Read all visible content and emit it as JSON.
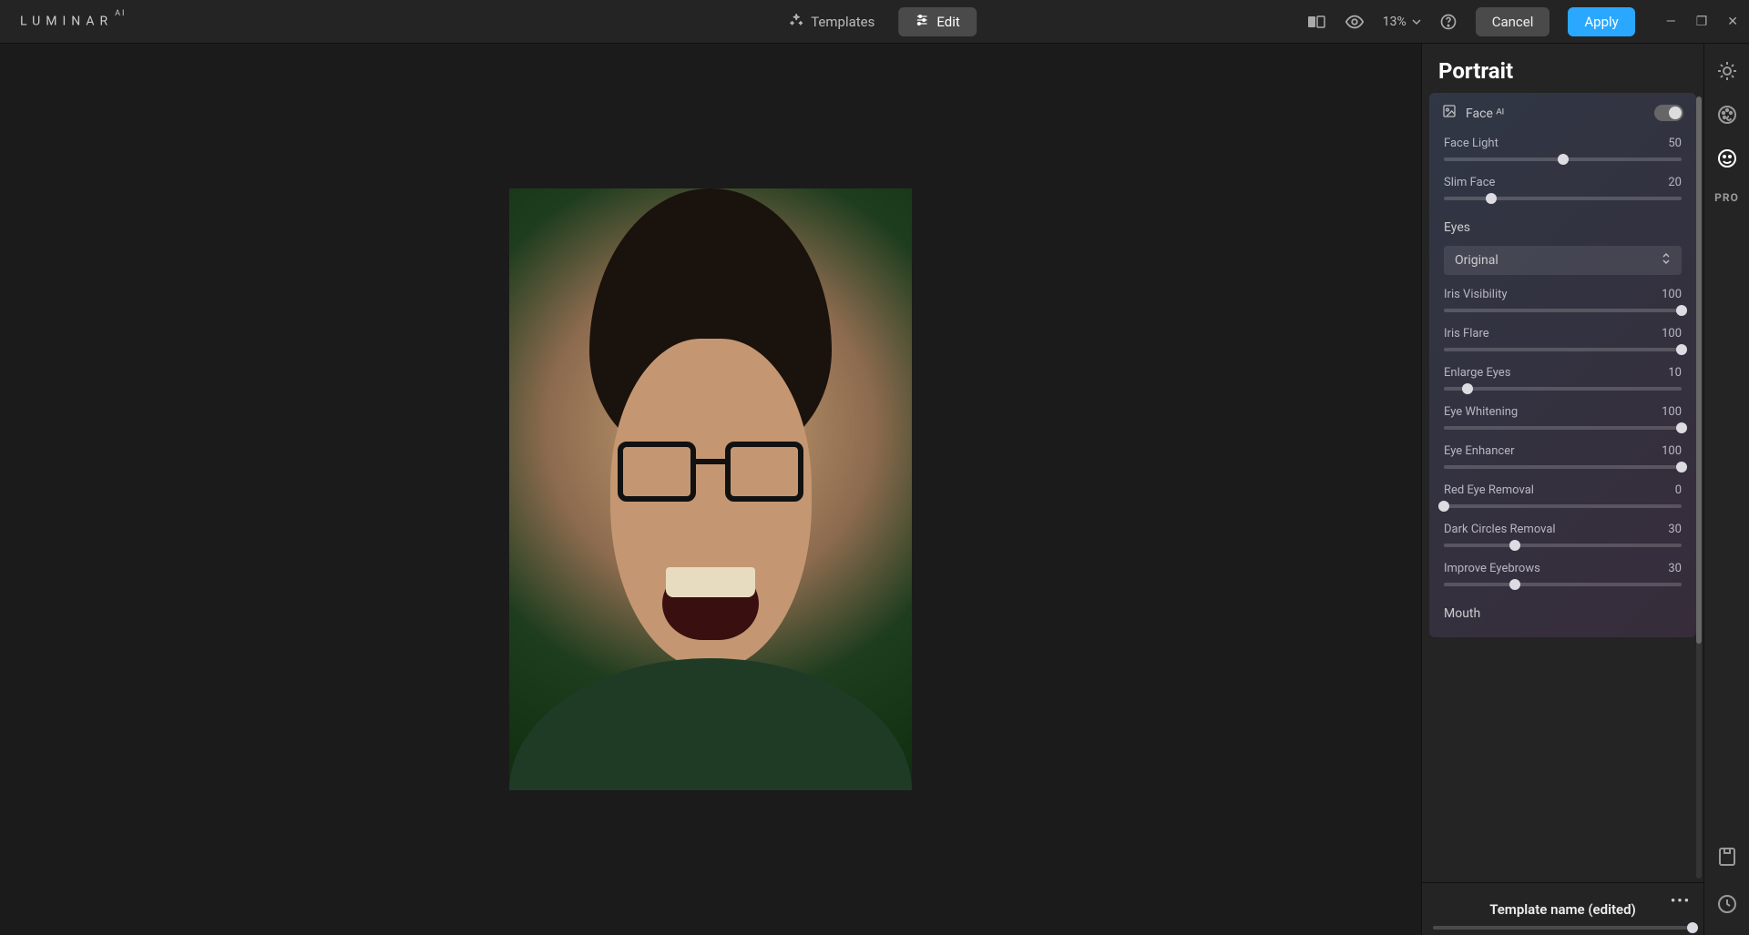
{
  "app": {
    "brand": "LUMINAR",
    "brand_sup": "AI"
  },
  "topbar": {
    "tabs": {
      "templates": "Templates",
      "edit": "Edit"
    },
    "zoom": "13%",
    "cancel": "Cancel",
    "apply": "Apply"
  },
  "panel": {
    "title": "Portrait",
    "face_section": "Face ᴬᴵ",
    "eyes_section": "Eyes",
    "mouth_section": "Mouth",
    "eyes_select": "Original",
    "sliders": {
      "face_light": {
        "label": "Face Light",
        "value": 50,
        "max": 100
      },
      "slim_face": {
        "label": "Slim Face",
        "value": 20,
        "max": 100
      },
      "iris_vis": {
        "label": "Iris Visibility",
        "value": 100,
        "max": 100
      },
      "iris_flare": {
        "label": "Iris Flare",
        "value": 100,
        "max": 100
      },
      "enlarge_eyes": {
        "label": "Enlarge Eyes",
        "value": 10,
        "max": 100
      },
      "eye_whiten": {
        "label": "Eye Whitening",
        "value": 100,
        "max": 100
      },
      "eye_enhance": {
        "label": "Eye Enhancer",
        "value": 100,
        "max": 100
      },
      "red_eye": {
        "label": "Red Eye Removal",
        "value": 0,
        "max": 100
      },
      "dark_circles": {
        "label": "Dark Circles Removal",
        "value": 30,
        "max": 100
      },
      "eyebrows": {
        "label": "Improve Eyebrows",
        "value": 30,
        "max": 100
      }
    }
  },
  "template_bar": {
    "label": "Template name (edited)"
  },
  "rail": {
    "pro": "PRO"
  }
}
